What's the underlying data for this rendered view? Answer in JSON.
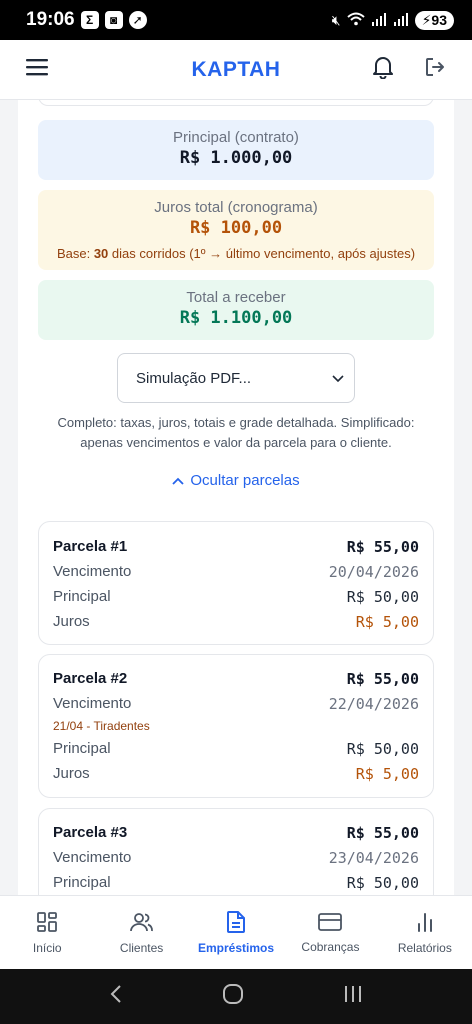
{
  "status": {
    "time": "19:06",
    "battery": "93"
  },
  "header": {
    "brand": "KAPTAH"
  },
  "summary": {
    "principal_label": "Principal (contrato)",
    "principal_value": "R$ 1.000,00",
    "juros_label": "Juros total (cronograma)",
    "juros_value": "R$ 100,00",
    "juros_base_prefix": "Base: ",
    "juros_base_days": "30",
    "juros_base_suffix": " dias corridos (1º → último vencimento, após ajustes)",
    "total_label": "Total a receber",
    "total_value": "R$ 1.100,00"
  },
  "pdf_select": {
    "value": "Simulação PDF..."
  },
  "hint": "Completo: taxas, juros, totais e grade detalhada. Simplificado: apenas vencimentos e valor da parcela para o cliente.",
  "toggle_label": "Ocultar parcelas",
  "parcels": [
    {
      "title": "Parcela #1",
      "total": "R$ 55,00",
      "venc_label": "Vencimento",
      "venc_date": "20/04/2026",
      "principal_label": "Principal",
      "principal": "R$ 50,00",
      "juros_label": "Juros",
      "juros": "R$ 5,00"
    },
    {
      "title": "Parcela #2",
      "total": "R$ 55,00",
      "venc_label": "Vencimento",
      "venc_date": "22/04/2026",
      "holiday": "21/04 - Tiradentes",
      "principal_label": "Principal",
      "principal": "R$ 50,00",
      "juros_label": "Juros",
      "juros": "R$ 5,00"
    },
    {
      "title": "Parcela #3",
      "total": "R$ 55,00",
      "venc_label": "Vencimento",
      "venc_date": "23/04/2026",
      "principal_label": "Principal",
      "principal": "R$ 50,00"
    }
  ],
  "nav": [
    {
      "label": "Início",
      "icon": "grid-icon"
    },
    {
      "label": "Clientes",
      "icon": "users-icon"
    },
    {
      "label": "Empréstimos",
      "icon": "document-icon",
      "active": true
    },
    {
      "label": "Cobranças",
      "icon": "card-icon"
    },
    {
      "label": "Relatórios",
      "icon": "bar-chart-icon"
    }
  ],
  "colors": {
    "accent": "#2563eb",
    "interest": "#b45309",
    "total": "#047857"
  }
}
